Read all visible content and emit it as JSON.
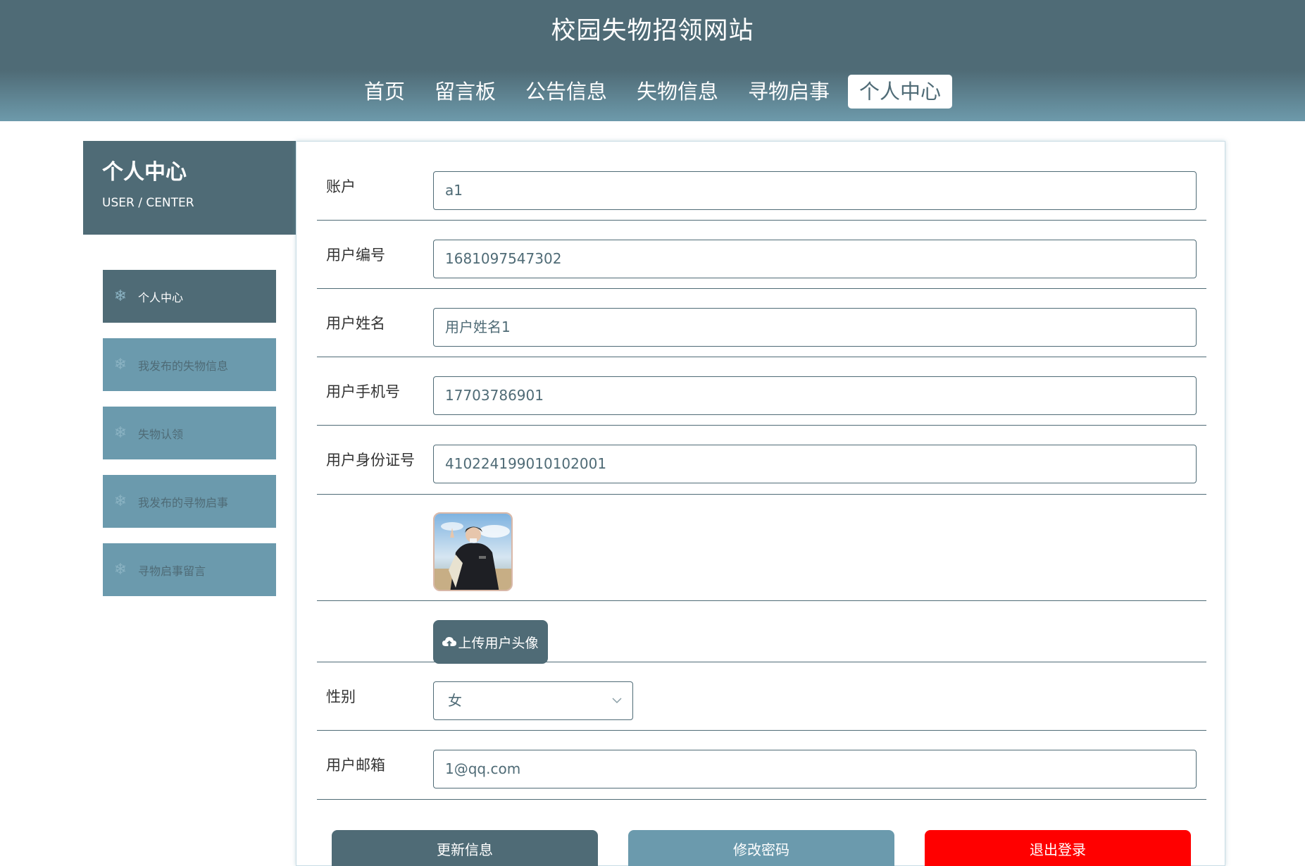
{
  "header": {
    "title": "校园失物招领网站",
    "nav": [
      "首页",
      "留言板",
      "公告信息",
      "失物信息",
      "寻物启事",
      "个人中心"
    ],
    "active_nav": "个人中心"
  },
  "sidebar": {
    "title": "个人中心",
    "subtitle": "USER / CENTER",
    "items": [
      {
        "label": "个人中心",
        "icon": "snowflake-icon"
      },
      {
        "label": "我发布的失物信息",
        "icon": "snowflake-icon"
      },
      {
        "label": "失物认领",
        "icon": "snowflake-icon"
      },
      {
        "label": "我发布的寻物启事",
        "icon": "snowflake-icon"
      },
      {
        "label": "寻物启事留言",
        "icon": "snowflake-icon"
      }
    ]
  },
  "form": {
    "account": {
      "label": "账户",
      "value": "a1"
    },
    "user_no": {
      "label": "用户编号",
      "value": "1681097547302"
    },
    "user_name": {
      "label": "用户姓名",
      "value": "用户姓名1"
    },
    "phone": {
      "label": "用户手机号",
      "value": "17703786901"
    },
    "id_card": {
      "label": "用户身份证号",
      "value": "410224199010102001"
    },
    "upload_label": "上传用户头像",
    "gender": {
      "label": "性别",
      "value": "女"
    },
    "email": {
      "label": "用户邮箱",
      "value": "1@qq.com"
    }
  },
  "actions": {
    "update": "更新信息",
    "change_password": "修改密码",
    "logout": "退出登录"
  },
  "colors": {
    "primary": "#4f6b76",
    "secondary": "#6b9aad",
    "danger": "#ff0000"
  }
}
